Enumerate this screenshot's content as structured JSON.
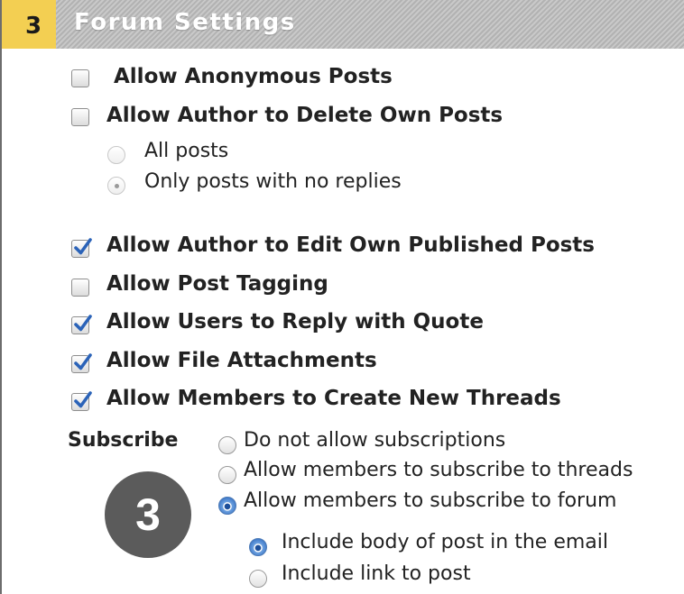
{
  "section": {
    "step_number": "3",
    "title": "Forum Settings"
  },
  "options": [
    {
      "label": "Allow Anonymous Posts",
      "checked": false
    },
    {
      "label": "Allow Author to Delete Own Posts",
      "checked": false
    },
    {
      "label": "Allow Author to Edit Own Published Posts",
      "checked": true
    },
    {
      "label": "Allow Post Tagging",
      "checked": false
    },
    {
      "label": "Allow Users to Reply with Quote",
      "checked": true
    },
    {
      "label": "Allow File Attachments",
      "checked": true
    },
    {
      "label": "Allow Members to Create New Threads",
      "checked": true
    }
  ],
  "delete_scope": {
    "choices": [
      "All posts",
      "Only posts with no replies"
    ],
    "selected": "Only posts with no replies",
    "enabled": false
  },
  "subscribe": {
    "label": "Subscribe",
    "choices": [
      "Do not allow subscriptions",
      "Allow members to subscribe to threads",
      "Allow members to subscribe to forum"
    ],
    "selected": "Allow members to subscribe to forum",
    "email_choices": [
      "Include body of post in the email",
      "Include link to post"
    ],
    "email_selected": "Include body of post in the email"
  },
  "callout": {
    "number": "3"
  },
  "colors": {
    "step_tab": "#f3cf52",
    "title_bar": "#bdbdbd",
    "check_blue": "#2b63b8",
    "badge": "#5b5b5b"
  }
}
